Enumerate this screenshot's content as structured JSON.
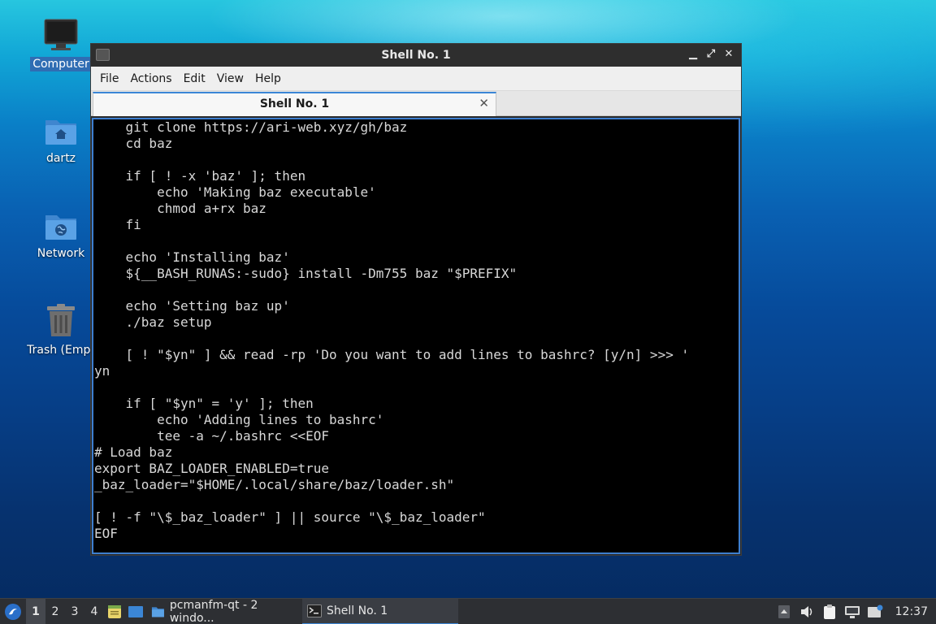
{
  "desktop": {
    "icons": [
      {
        "label": "Computer",
        "icon": "computer-icon"
      },
      {
        "label": "dartz",
        "icon": "home-folder-icon"
      },
      {
        "label": "Network",
        "icon": "network-folder-icon"
      },
      {
        "label": "Trash (Empt",
        "icon": "trash-icon"
      }
    ]
  },
  "window": {
    "title": "Shell No. 1",
    "menu": [
      "File",
      "Actions",
      "Edit",
      "View",
      "Help"
    ],
    "tab_label": "Shell No. 1",
    "terminal_text": "    git clone https://ari-web.xyz/gh/baz\n    cd baz\n\n    if [ ! -x 'baz' ]; then\n        echo 'Making baz executable'\n        chmod a+rx baz\n    fi\n\n    echo 'Installing baz'\n    ${__BASH_RUNAS:-sudo} install -Dm755 baz \"$PREFIX\"\n\n    echo 'Setting baz up'\n    ./baz setup\n\n    [ ! \"$yn\" ] && read -rp 'Do you want to add lines to bashrc? [y/n] >>> '\nyn\n\n    if [ \"$yn\" = 'y' ]; then\n        echo 'Adding lines to bashrc'\n        tee -a ~/.bashrc <<EOF\n# Load baz\nexport BAZ_LOADER_ENABLED=true\n_baz_loader=\"$HOME/.local/share/baz/loader.sh\"\n\n[ ! -f \"\\$_baz_loader\" ] || source \"\\$_baz_loader\"\nEOF"
  },
  "taskbar": {
    "workspaces": [
      "1",
      "2",
      "3",
      "4"
    ],
    "active_workspace": "1",
    "tasks": [
      {
        "label": "pcmanfm-qt - 2 windo...",
        "icon": "folder-icon"
      },
      {
        "label": "Shell No. 1",
        "icon": "terminal-icon"
      }
    ],
    "clock": "12:37"
  },
  "colors": {
    "accent": "#3b86d6",
    "terminal_bg": "#000000",
    "terminal_fg": "#d8d8d8"
  }
}
